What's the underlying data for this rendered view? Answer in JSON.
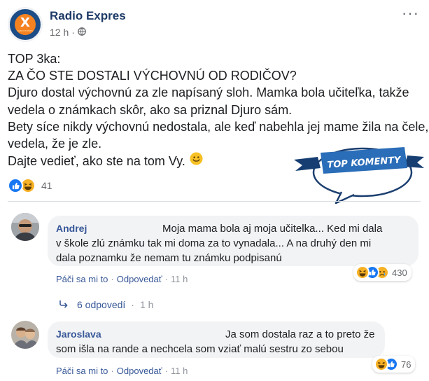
{
  "post": {
    "page_name": "Radio Expres",
    "time": "12 h",
    "logo_text": "X",
    "logo_sub": "RADIO EXPRES",
    "lines": [
      "TOP 3ka:",
      "ZA ČO STE DOSTALI VÝCHOVNÚ OD RODIČOV?",
      "Djuro dostal výchovnú za zle napísaný sloh. Mamka bola učiteľka, takže",
      "vedela o známkach skôr, ako sa priznal Djuro sám.",
      "Bety síce nikdy výchovnú nedostala, ale keď nabehla jej mame žila na čele,",
      "vedela, že je zle.",
      "Dajte vedieť, ako ste na tom Vy."
    ],
    "reaction_count": "41",
    "badge_text": "TOP KOMENTY"
  },
  "comments": [
    {
      "name": "Andrej",
      "lines": [
        "Moja mama bola aj moja učitelka... Ked mi dala",
        "v škole zlú známku tak mi doma za to vynadala... A na druhý den mi",
        "dala poznamku že nemam tu známku podpisanú"
      ],
      "like_label": "Páči sa mi to",
      "reply_label": "Odpovedať",
      "time": "11 h",
      "reaction_count": "430"
    },
    {
      "name": "Jaroslava",
      "lines": [
        "Ja som dostala raz a to preto že",
        "som išla na rande a nechcela som vziať malú sestru zo sebou"
      ],
      "like_label": "Páči sa mi to",
      "reply_label": "Odpovedať",
      "time": "11 h",
      "reaction_count": "76"
    }
  ],
  "replies": {
    "label": "6 odpovedí",
    "time": "1 h"
  },
  "icons": {
    "globe": "globe-icon",
    "more": "more-options-icon",
    "like": "like-reaction-icon",
    "haha": "haha-reaction-icon",
    "sad": "sad-reaction-icon",
    "smile": "smile-emoji-icon",
    "reply_arrow": "reply-arrow-icon"
  },
  "colors": {
    "link": "#385898",
    "page_name": "#1d3a66",
    "like_blue": "#1877f2",
    "emoji_yellow": "#f7b125",
    "bubble": "#f2f3f5",
    "logo_orange": "#f58220",
    "logo_blue": "#1d4d86"
  }
}
